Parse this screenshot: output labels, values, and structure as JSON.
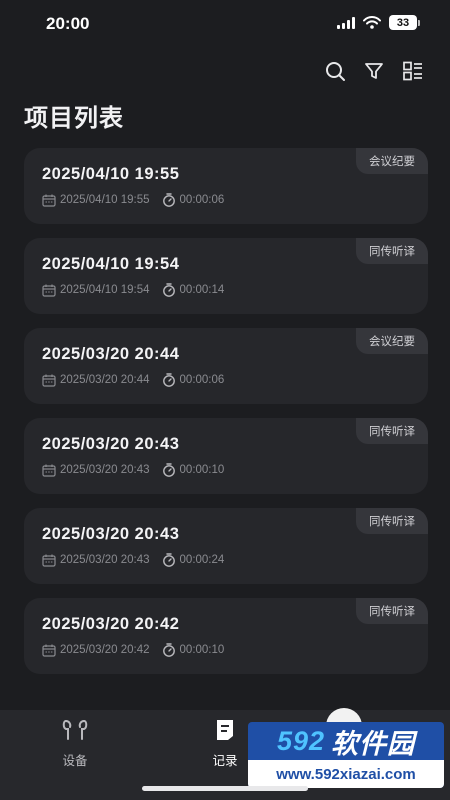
{
  "status_bar": {
    "time": "20:00",
    "battery": "33"
  },
  "toolbar": {
    "icons": [
      "search-icon",
      "filter-icon",
      "list-view-icon"
    ]
  },
  "page": {
    "title": "项目列表"
  },
  "records": [
    {
      "title": "2025/04/10 19:55",
      "date": "2025/04/10 19:55",
      "duration": "00:00:06",
      "tag": "会议纪要"
    },
    {
      "title": "2025/04/10 19:54",
      "date": "2025/04/10 19:54",
      "duration": "00:00:14",
      "tag": "同传听译"
    },
    {
      "title": "2025/03/20 20:44",
      "date": "2025/03/20 20:44",
      "duration": "00:00:06",
      "tag": "会议纪要"
    },
    {
      "title": "2025/03/20 20:43",
      "date": "2025/03/20 20:43",
      "duration": "00:00:10",
      "tag": "同传听译"
    },
    {
      "title": "2025/03/20 20:43",
      "date": "2025/03/20 20:43",
      "duration": "00:00:24",
      "tag": "同传听译"
    },
    {
      "title": "2025/03/20 20:42",
      "date": "2025/03/20 20:42",
      "duration": "00:00:10",
      "tag": "同传听译"
    }
  ],
  "tabs": [
    {
      "label": "设备",
      "icon": "earbuds-icon",
      "active": false
    },
    {
      "label": "记录",
      "icon": "document-icon",
      "active": true
    }
  ],
  "watermark": {
    "brand_num": "592",
    "brand_text": "软件园",
    "url": "www.592xiazai.com"
  }
}
